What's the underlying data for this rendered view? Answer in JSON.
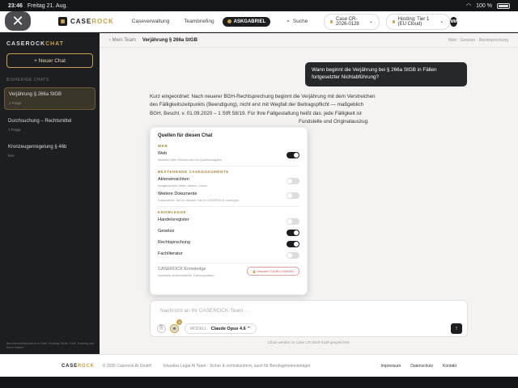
{
  "status": {
    "time": "23:46",
    "date": "Freitag 21. Aug.",
    "battery": "100 %"
  },
  "nav": {
    "brand_main": "CASE",
    "brand_accent": "ROCK",
    "items": [
      "Caseverwaltung",
      "Teambriefing"
    ],
    "ask_label": "ASKGABRIEL",
    "search_label": "Suche",
    "case_label": "Case CR-2026-0128",
    "hosting_label": "Hosting: Tier 1 (EU Cloud)",
    "avatar_initials": "MM"
  },
  "sidebar": {
    "title_main": "CASEROCK",
    "title_accent": "CHAT",
    "new_chat": "+ Neuer Chat",
    "section": "BISHERIGE CHATS",
    "chats": [
      {
        "title": "Verjährung § 266a StGB",
        "meta": "1 Frage"
      },
      {
        "title": "Durchsuchung – Rechtsmittel",
        "meta": "1 Frage"
      },
      {
        "title": "Kronzeugenregelung § 46b",
        "meta": "leer"
      }
    ],
    "footer": "Berufsrechtskonform in Ihrer Hosting-Stufe. Kein Training auf Ihren Daten."
  },
  "main": {
    "back": "‹ Mein Team",
    "title": "Verjährung § 266a StGB",
    "tags": "Web · Gesetze · Rechtsprechung",
    "question": "Wann beginnt die Verjährung bei § 266a StGB in Fällen fortgesetzter Nichtabführung?",
    "answer_lines": [
      "Kurz eingeordnet: Nach neuerer BGH-Rechtsprechung beginnt die Verjährung mit dem Verstreichen",
      "des Fälligkeitszeitpunkts (Beendigung), nicht erst mit Wegfall der Beitragspflicht — maßgeblich",
      "BGH, Beschl. v. 01.09.2020 – 1 StR 58/19. Für Ihre Fallgestaltung heißt das: jede Fälligkeit ist"
    ],
    "answer_tail": "Fundstelle und Originalauszug.",
    "composer_placeholder": "Nachricht an Ihr CASEROCK-Team …",
    "sources_count": "3",
    "model_label": "MODELL",
    "model_value": "Claude Opus 4.6 ⌃",
    "case_saved": "Chats werden im Case CR-2026-0128 gespeichert."
  },
  "popover": {
    "title": "Quellen für diesen Chat",
    "sec_web": "WEB",
    "web": {
      "label": "Web",
      "sub": "Aktuelle Web-Recherche mit Quellenangabe",
      "on": true
    },
    "sec_docs": "BESTEHENDE CASEDOKUMENTE",
    "akte": {
      "label": "Akteneinsichten",
      "sub": "Ausgewertete Akten dieses Cases",
      "on": false
    },
    "docs": {
      "label": "Weitere Dokumente",
      "sub": "Dokumente, die zu diesem Fall in CASEROCK vorliegen",
      "on": false
    },
    "sec_know": "KNOWLEDGE",
    "knowledge": [
      {
        "label": "Handelsregister",
        "on": false
      },
      {
        "label": "Gesetze",
        "on": true
      },
      {
        "label": "Rechtsprechung",
        "on": true
      },
      {
        "label": "Fachliteratur",
        "on": false
      }
    ],
    "ck": {
      "label": "CASEROCK Knowledge",
      "sub": "Spezielle strafrechtliche Trainingsdaten",
      "req": "🔒 erfordert CASECOUNSEL"
    }
  },
  "footer": {
    "brand_main": "CASE",
    "brand_accent": "ROCK",
    "copy": "© 2026 Caserock AI GmbH",
    "tagline": "Virtuelles Legal AI Team · Sicher & rechtskonform, auch für Berufsgeheimnisträger",
    "links": [
      "Impressum",
      "Datenschutz",
      "Kontakt"
    ]
  }
}
